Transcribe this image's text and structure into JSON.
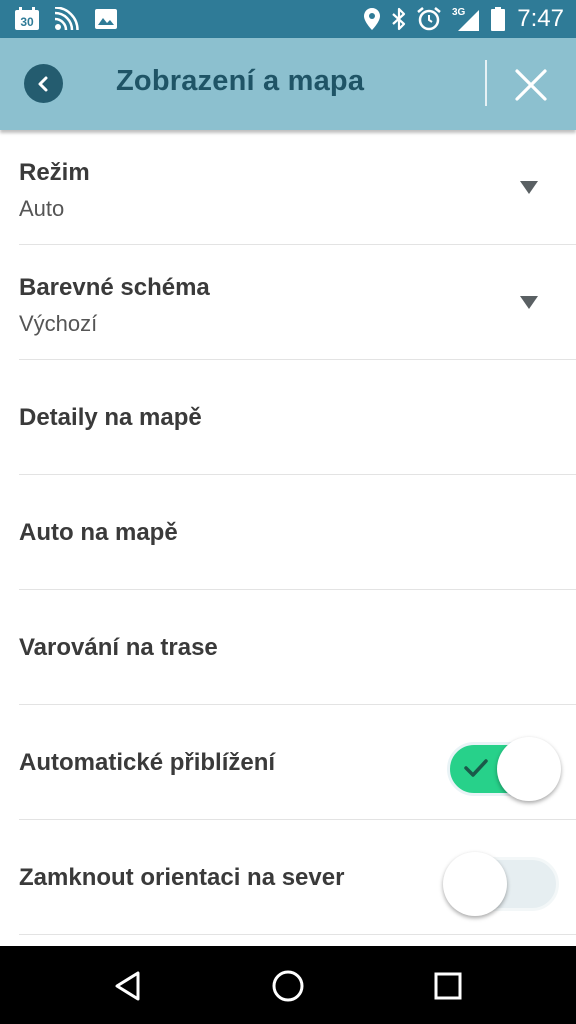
{
  "status_bar": {
    "time": "7:47",
    "calendar_day": "30",
    "network_label": "3G",
    "icons": [
      "calendar-icon",
      "wifi-signal-icon",
      "image-icon",
      "location-icon",
      "bluetooth-icon",
      "alarm-icon",
      "cell-signal-icon",
      "battery-icon"
    ],
    "color": "#2f7b97"
  },
  "header": {
    "title": "Zobrazení a mapa",
    "back_icon": "chevron-left-icon",
    "close_icon": "close-icon",
    "background": "#8cc0cf",
    "title_color": "#1f5466"
  },
  "settings": {
    "rezim": {
      "label": "Režim",
      "value": "Auto"
    },
    "barevne_schema": {
      "label": "Barevné schéma",
      "value": "Výchozí"
    },
    "detaily": {
      "label": "Detaily na mapě"
    },
    "auto_na_mape": {
      "label": "Auto na mapě"
    },
    "varovani": {
      "label": "Varování na trase"
    },
    "auto_zoom": {
      "label": "Automatické přiblížení",
      "enabled": true
    },
    "north_lock": {
      "label": "Zamknout orientaci na sever",
      "enabled": false
    }
  },
  "colors": {
    "toggle_on": "#27d18a",
    "toggle_off": "#e6eef1"
  },
  "nav_bar": {
    "buttons": [
      "back-triangle-icon",
      "home-circle-icon",
      "recents-square-icon"
    ]
  }
}
